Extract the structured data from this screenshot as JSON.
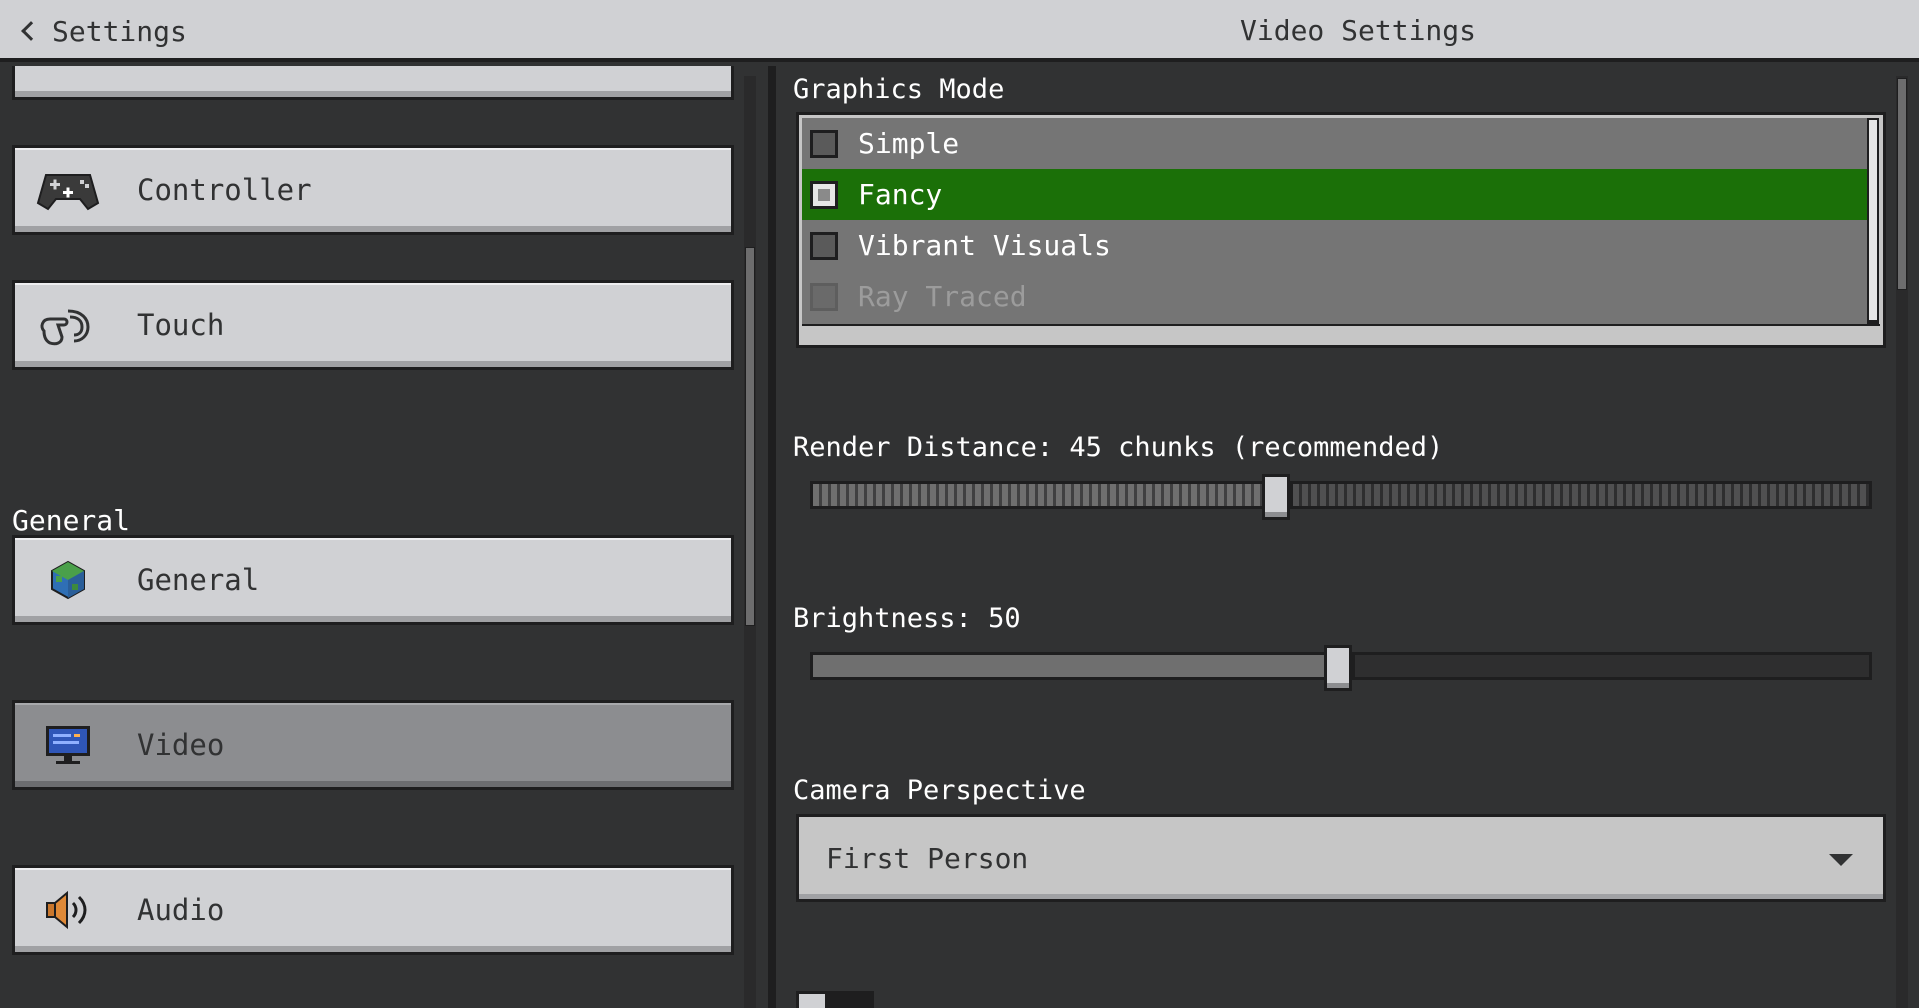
{
  "header": {
    "back_label": "Settings",
    "title": "Video Settings"
  },
  "sidebar": {
    "section_label": "General",
    "items": [
      {
        "label": "Controller",
        "icon": "controller-icon"
      },
      {
        "label": "Touch",
        "icon": "touch-icon"
      },
      {
        "label": "General",
        "icon": "globe-cube-icon"
      },
      {
        "label": "Video",
        "icon": "monitor-icon",
        "active": true
      },
      {
        "label": "Audio",
        "icon": "speaker-icon"
      }
    ]
  },
  "video": {
    "graphics_mode": {
      "label": "Graphics Mode",
      "options": [
        {
          "label": "Simple",
          "checked": false,
          "disabled": false
        },
        {
          "label": "Fancy",
          "checked": true,
          "disabled": false
        },
        {
          "label": "Vibrant Visuals",
          "checked": false,
          "disabled": false
        },
        {
          "label": "Ray Traced",
          "checked": false,
          "disabled": true
        }
      ]
    },
    "render_distance": {
      "label": "Render Distance: 45 chunks (recommended)",
      "value_fraction": 0.44
    },
    "brightness": {
      "label": "Brightness: 50",
      "value_fraction": 0.5
    },
    "camera_perspective": {
      "label": "Camera Perspective",
      "value": "First Person"
    }
  },
  "colors": {
    "accent_selected": "#1b7008",
    "panel_bg": "#313233",
    "button_bg": "#d0d1d4"
  }
}
